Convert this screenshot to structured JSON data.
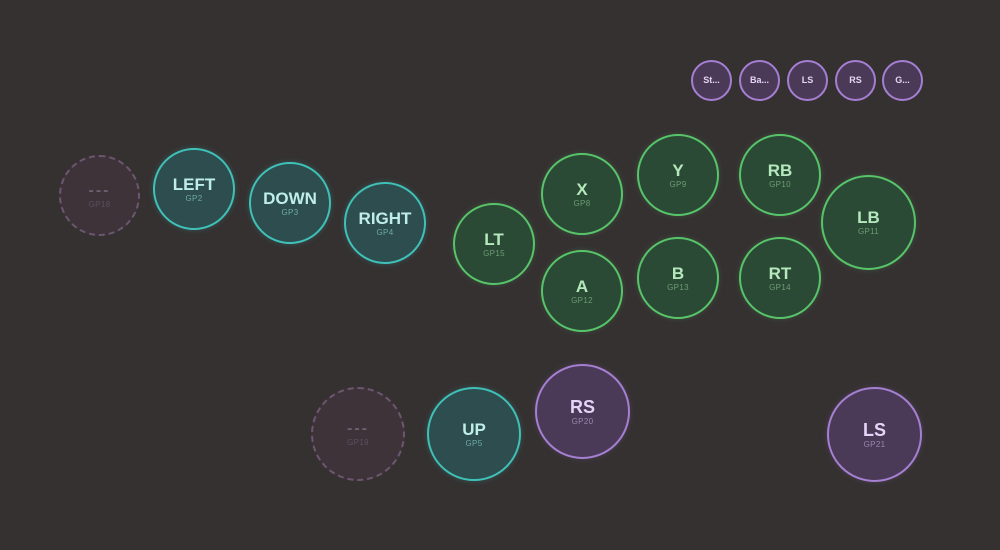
{
  "top_row": [
    {
      "label": "St..."
    },
    {
      "label": "Ba..."
    },
    {
      "label": "LS"
    },
    {
      "label": "RS"
    },
    {
      "label": "G..."
    }
  ],
  "buttons": {
    "gp18": {
      "label": "---",
      "gp": "GP18"
    },
    "left": {
      "label": "LEFT",
      "gp": "GP2"
    },
    "down": {
      "label": "DOWN",
      "gp": "GP3"
    },
    "right": {
      "label": "RIGHT",
      "gp": "GP4"
    },
    "lt": {
      "label": "LT",
      "gp": "GP15"
    },
    "x": {
      "label": "X",
      "gp": "GP8"
    },
    "a": {
      "label": "A",
      "gp": "GP12"
    },
    "y": {
      "label": "Y",
      "gp": "GP9"
    },
    "b": {
      "label": "B",
      "gp": "GP13"
    },
    "rb": {
      "label": "RB",
      "gp": "GP10"
    },
    "rt": {
      "label": "RT",
      "gp": "GP14"
    },
    "lb": {
      "label": "LB",
      "gp": "GP11"
    },
    "gp19": {
      "label": "---",
      "gp": "GP19"
    },
    "up": {
      "label": "UP",
      "gp": "GP5"
    },
    "rs": {
      "label": "RS",
      "gp": "GP20"
    },
    "ls": {
      "label": "LS",
      "gp": "GP21"
    }
  },
  "colors": {
    "background": "#353131",
    "teal": "#3fc1b8",
    "green": "#58c46a",
    "purple": "#a57fd2"
  }
}
